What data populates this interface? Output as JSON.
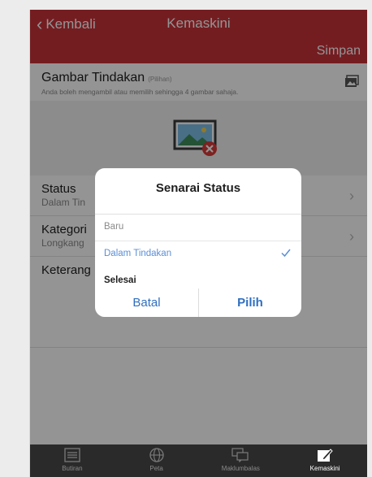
{
  "header": {
    "back_label": "Kembali",
    "title": "Kemaskini",
    "save_label": "Simpan"
  },
  "photo": {
    "title": "Gambar Tindakan",
    "optional": "(Pilihan)",
    "subtitle": "Anda boleh mengambil atau memilih sehingga 4 gambar sahaja."
  },
  "fields": {
    "status": {
      "label": "Status",
      "value": "Dalam Tin"
    },
    "kategori": {
      "label": "Kategori",
      "value": "Longkang"
    },
    "keterangan": {
      "label": "Keterang"
    }
  },
  "dialog": {
    "title": "Senarai Status",
    "options": [
      {
        "label": "Baru",
        "state": "disabled"
      },
      {
        "label": "Dalam Tindakan",
        "state": "selected"
      },
      {
        "label": "Selesai",
        "state": "normal"
      }
    ],
    "cancel_label": "Batal",
    "confirm_label": "Pilih"
  },
  "tabs": [
    {
      "label": "Butiran",
      "icon": "list-icon",
      "active": false
    },
    {
      "label": "Peta",
      "icon": "globe-icon",
      "active": false
    },
    {
      "label": "Maklumbalas",
      "icon": "chat-icon",
      "active": false
    },
    {
      "label": "Kemaskini",
      "icon": "edit-icon",
      "active": true
    }
  ],
  "colors": {
    "header": "#c8323a",
    "accent": "#2f6fc0",
    "selected": "#5a8fd8",
    "tabbar": "#2a2a2a"
  }
}
